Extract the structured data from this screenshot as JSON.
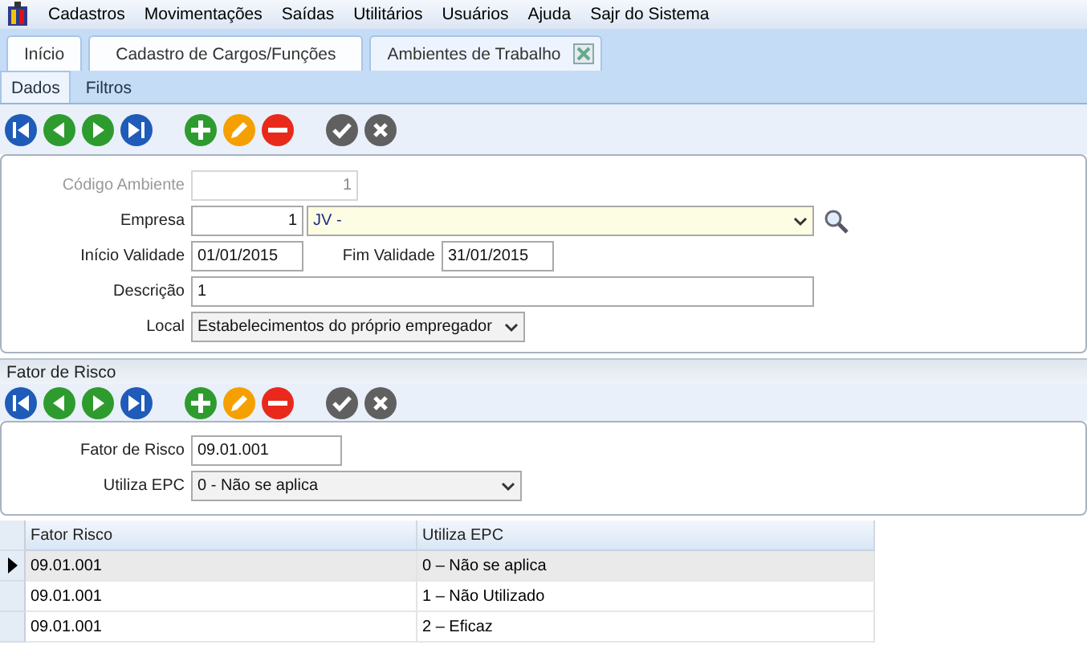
{
  "menu": [
    "Cadastros",
    "Movimentações",
    "Saídas",
    "Utilitários",
    "Usuários",
    "Ajuda",
    "Sajr do Sistema"
  ],
  "tabs": [
    {
      "label": "Início",
      "selected": false,
      "closable": false
    },
    {
      "label": "Cadastro de Cargos/Funções",
      "selected": false,
      "closable": false
    },
    {
      "label": "Ambientes de Trabalho",
      "selected": true,
      "closable": true
    }
  ],
  "subtabs": [
    {
      "label": "Dados",
      "selected": true
    },
    {
      "label": "Filtros",
      "selected": false
    }
  ],
  "toolbar": [
    {
      "kind": "first"
    },
    {
      "kind": "prev"
    },
    {
      "kind": "next"
    },
    {
      "kind": "last"
    },
    {
      "kind": "gap"
    },
    {
      "kind": "add"
    },
    {
      "kind": "edit"
    },
    {
      "kind": "delete"
    },
    {
      "kind": "gap"
    },
    {
      "kind": "confirm"
    },
    {
      "kind": "cancel"
    }
  ],
  "form": {
    "codigo": {
      "label": "Código Ambiente",
      "value": "1",
      "disabled": true
    },
    "empresa": {
      "label": "Empresa",
      "code": "1",
      "name": "JV -"
    },
    "inicio": {
      "label": "Início Validade",
      "value": "01/01/2015"
    },
    "fim": {
      "label": "Fim Validade",
      "value": "31/01/2015"
    },
    "descricao": {
      "label": "Descrição",
      "value": "1"
    },
    "local": {
      "label": "Local",
      "value": "Estabelecimentos do próprio empregador"
    }
  },
  "section_title": "Fator de Risco",
  "toolbar2": [
    {
      "kind": "first"
    },
    {
      "kind": "prev"
    },
    {
      "kind": "next"
    },
    {
      "kind": "last"
    },
    {
      "kind": "gap"
    },
    {
      "kind": "add"
    },
    {
      "kind": "edit"
    },
    {
      "kind": "delete"
    },
    {
      "kind": "gap"
    },
    {
      "kind": "confirm"
    },
    {
      "kind": "cancel"
    }
  ],
  "form2": {
    "fator": {
      "label": "Fator de Risco",
      "value": "09.01.001"
    },
    "epc": {
      "label": "Utiliza EPC",
      "value": "0 - Não se aplica"
    }
  },
  "table": {
    "columns": [
      "Fator Risco",
      "Utiliza EPC"
    ],
    "rows": [
      {
        "cells": [
          "09.01.001",
          "0 – Não se aplica"
        ],
        "selected": true
      },
      {
        "cells": [
          "09.01.001",
          "1 – Não Utilizado"
        ],
        "selected": false
      },
      {
        "cells": [
          "09.01.001",
          "2 – Eficaz"
        ],
        "selected": false
      }
    ]
  }
}
